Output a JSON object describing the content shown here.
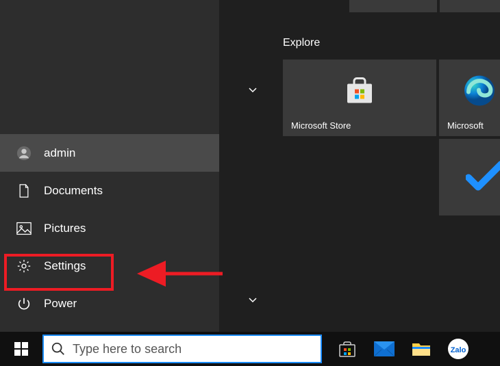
{
  "sidebar": {
    "items": [
      {
        "label": "admin",
        "icon": "user-icon",
        "selected": true
      },
      {
        "label": "Documents",
        "icon": "document-icon",
        "selected": false
      },
      {
        "label": "Pictures",
        "icon": "picture-icon",
        "selected": false
      },
      {
        "label": "Settings",
        "icon": "gear-icon",
        "selected": false
      },
      {
        "label": "Power",
        "icon": "power-icon",
        "selected": false
      }
    ]
  },
  "tiles_header": "Explore",
  "tiles": {
    "store": {
      "label": "Microsoft Store"
    },
    "edge": {
      "label": "Microsoft "
    },
    "office_a": {
      "label": ""
    },
    "office_b": {
      "label": ""
    }
  },
  "search": {
    "placeholder": "Type here to search"
  },
  "taskbar_apps": [
    {
      "name": "microsoft-store"
    },
    {
      "name": "mail"
    },
    {
      "name": "file-explorer"
    },
    {
      "name": "zalo"
    }
  ],
  "annotation": {
    "highlighted_item": "Settings"
  },
  "colors": {
    "accent": "#1a8cff",
    "highlight": "#ed1c24",
    "bg_dark": "#1f1f1f",
    "bg_panel": "#2d2d2d",
    "tile": "#3a3a3a"
  }
}
